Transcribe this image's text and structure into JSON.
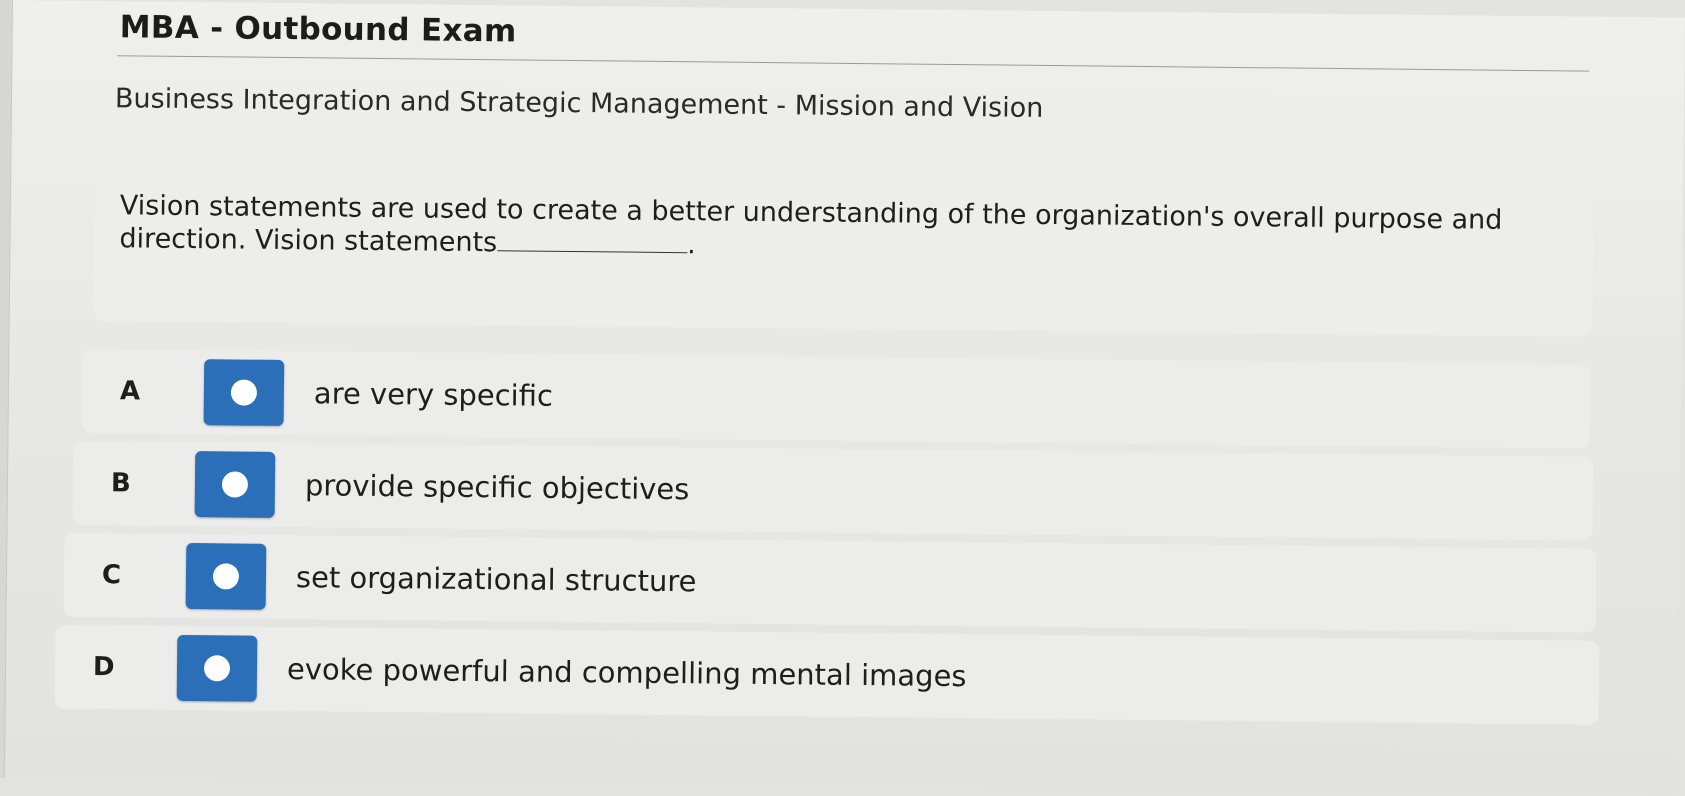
{
  "header": {
    "exam_title": "MBA - Outbound Exam",
    "subject": "Business Integration and Strategic Management - Mission and Vision"
  },
  "question": {
    "text": "Vision statements are used to create a better understanding of the organization's overall purpose and direction. Vision statements",
    "end_punctuation": "."
  },
  "options": [
    {
      "letter": "A",
      "text": "are very specific"
    },
    {
      "letter": "B",
      "text": "provide specific objectives"
    },
    {
      "letter": "C",
      "text": "set organizational structure"
    },
    {
      "letter": "D",
      "text": "evoke powerful and compelling mental images"
    }
  ],
  "colors": {
    "accent": "#2a6fb8",
    "background": "#e8e8e6",
    "panel": "#ececea"
  }
}
